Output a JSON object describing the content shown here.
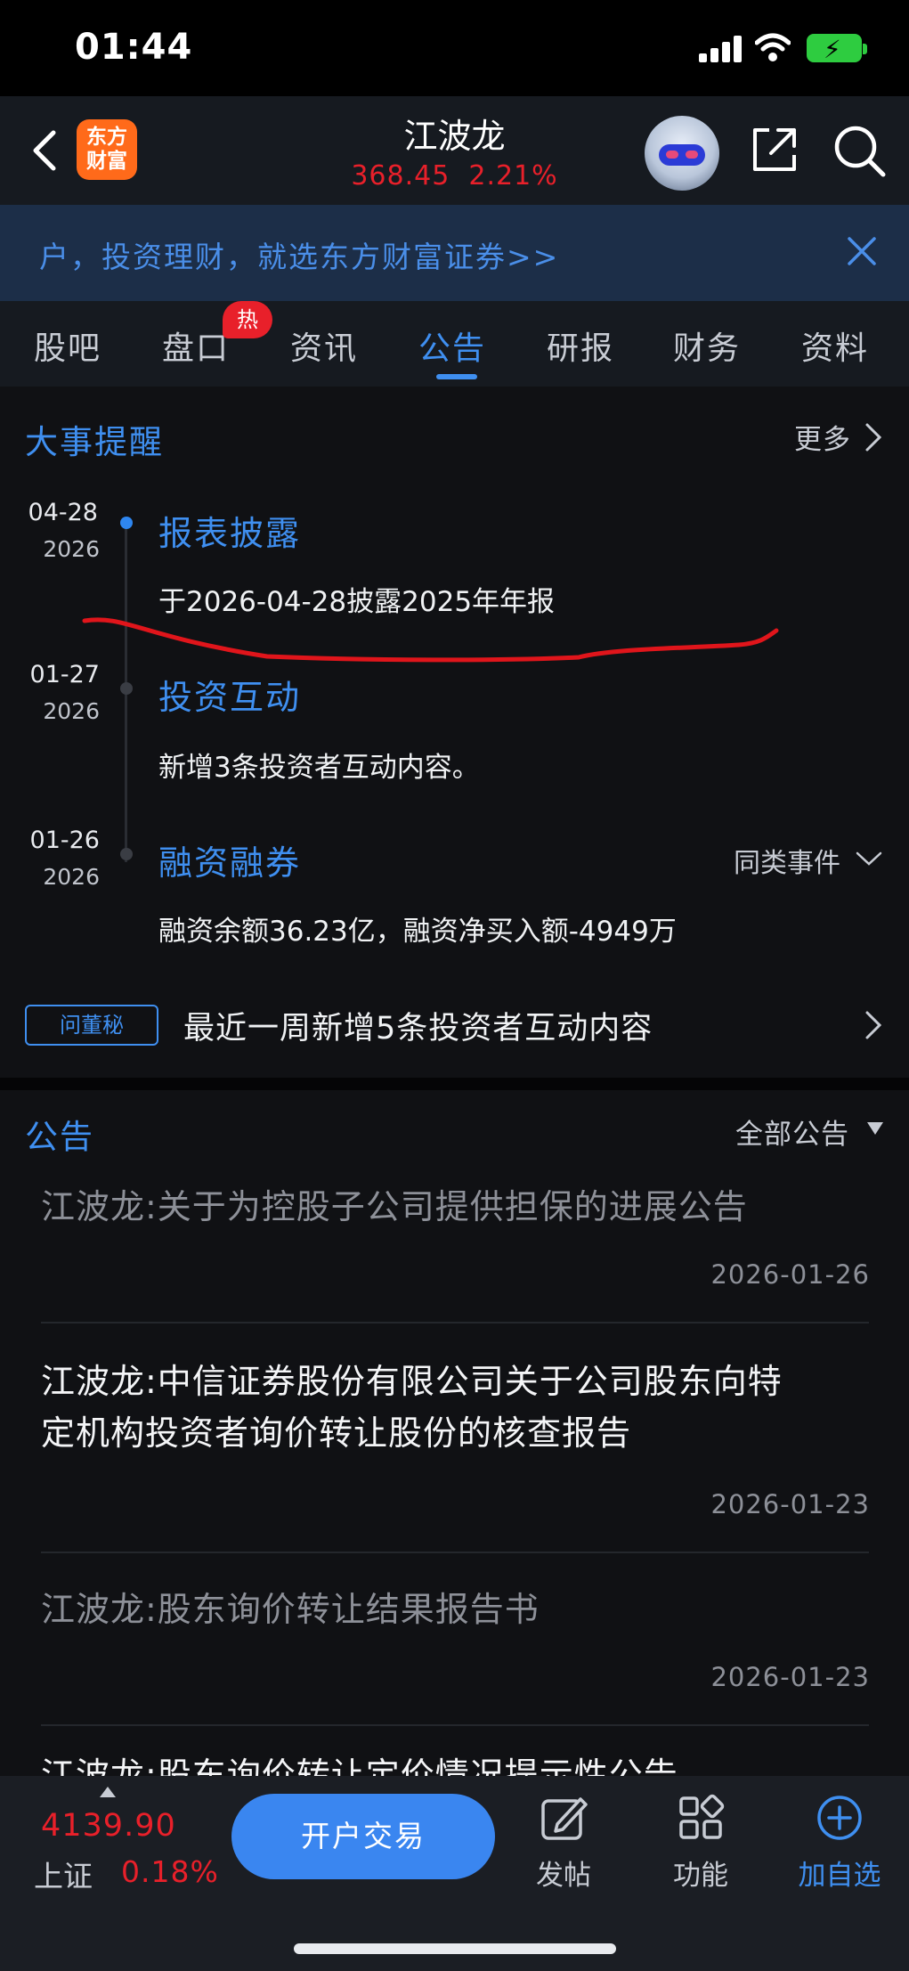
{
  "status_bar": {
    "time": "01:44"
  },
  "header": {
    "logo_line1": "东方",
    "logo_line2": "财富",
    "stock_name": "江波龙",
    "price": "368.45",
    "change_pct": "2.21%"
  },
  "banner": {
    "text": "户，投资理财，就选东方财富证券>>"
  },
  "tabs": [
    {
      "label": "股吧"
    },
    {
      "label": "盘口",
      "badge": "热"
    },
    {
      "label": "资讯"
    },
    {
      "label": "公告",
      "active": true
    },
    {
      "label": "研报"
    },
    {
      "label": "财务"
    },
    {
      "label": "资料"
    }
  ],
  "events": {
    "title": "大事提醒",
    "more": "更多",
    "items": [
      {
        "date": "04-28",
        "year": "2026",
        "title": "报表披露",
        "desc": "于2026-04-28披露2025年年报"
      },
      {
        "date": "01-27",
        "year": "2026",
        "title": "投资互动",
        "desc": "新增3条投资者互动内容。"
      },
      {
        "date": "01-26",
        "year": "2026",
        "title": "融资融券",
        "desc": "融资余额36.23亿，融资净买入额-4949万",
        "similar": "同类事件"
      }
    ],
    "dongmi_badge": "问董秘",
    "dongmi_text": "最近一周新增5条投资者互动内容"
  },
  "announcements": {
    "title": "公告",
    "filter": "全部公告",
    "items": [
      {
        "title": "江波龙:关于为控股子公司提供担保的进展公告",
        "date": "2026-01-26"
      },
      {
        "title_line1": "江波龙:中信证券股份有限公司关于公司股东向特",
        "title_line2": "定机构投资者询价转让股份的核查报告",
        "date": "2026-01-23"
      },
      {
        "title": "江波龙:股东询价转让结果报告书",
        "date": "2026-01-23"
      },
      {
        "title": "江波龙:股东询价转让定价情况提示性公告"
      }
    ]
  },
  "bottom_bar": {
    "index_value": "4139.90",
    "index_name": "上证",
    "index_change": "0.18%",
    "trade_button": "开户交易",
    "post_label": "发帖",
    "function_label": "功能",
    "add_label": "加自选"
  },
  "colors": {
    "accent_blue": "#3f8ff0",
    "up_red": "#e8202a",
    "background": "#101114",
    "annotation_red": "#e0151b"
  }
}
